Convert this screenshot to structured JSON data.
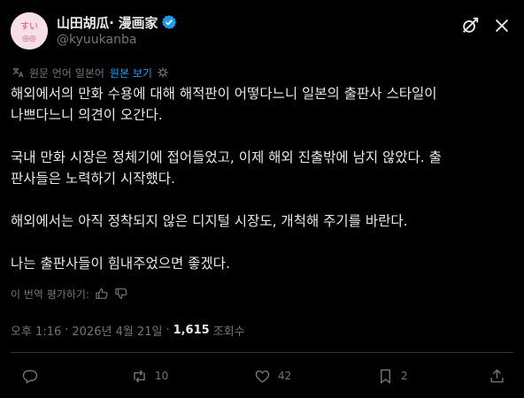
{
  "author": {
    "display_name": "山田胡瓜· 漫画家",
    "handle": "@kyuukanba",
    "verified": true,
    "avatar_text": "すい"
  },
  "translation": {
    "note": "원문 언어 일본어",
    "show_original": "원본 보기"
  },
  "post": {
    "paragraphs": [
      "해외에서의 만화 수용에 대해 해적판이 어떻다느니 일본의 출판사 스타일이\n나쁘다느니 의견이 오간다.",
      "국내 만화 시장은 정체기에 접어들었고, 이제 해외 진출밖에 남지 않았다. 출\n판사들은 노력하기 시작했다.",
      "해외에서는 아직 정착되지 않은 디지털 시장도, 개척해 주기를 바란다.",
      "나는 출판사들이 힘내주었으면 좋겠다."
    ]
  },
  "rate_translation": "이 번역 평가하기:",
  "meta": {
    "time": "오후 1:16",
    "date": "2026년 4월 21일",
    "views": "1,615",
    "views_label": "조회수"
  },
  "actions": {
    "replies": "",
    "reposts": "10",
    "likes": "42",
    "bookmarks": "2"
  },
  "colors": {
    "background": "#000000",
    "text": "#e7e9ea",
    "secondary": "#71767b",
    "accent": "#1d9bf0"
  },
  "icons": [
    "grok-icon",
    "more-icon",
    "translate-icon",
    "info-icon",
    "thumbs-up-icon",
    "thumbs-down-icon",
    "reply-icon",
    "repost-icon",
    "like-icon",
    "bookmark-icon",
    "share-icon",
    "verified-badge-icon"
  ]
}
